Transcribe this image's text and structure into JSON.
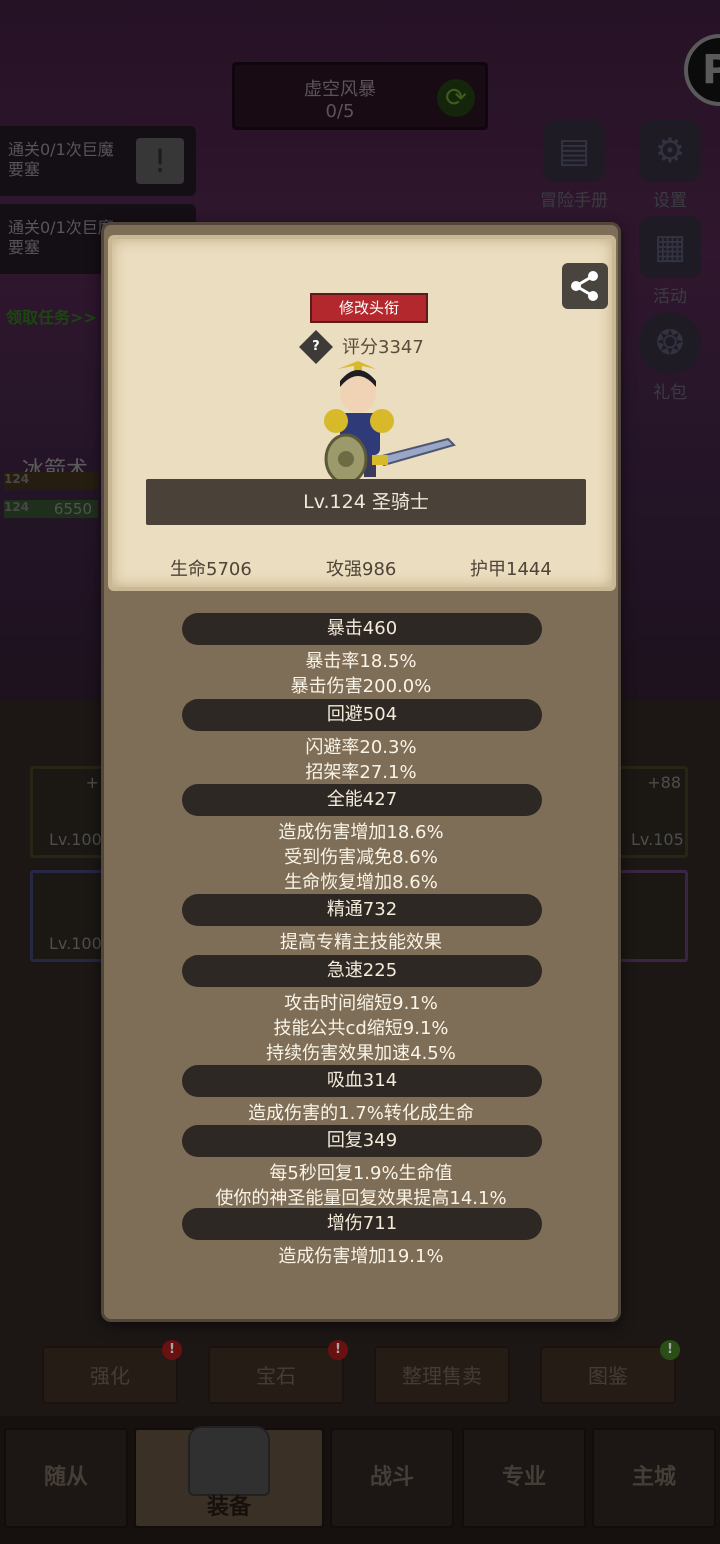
{
  "background": {
    "quest_title": "虚空风暴",
    "quest_progress": "0/5",
    "side_tasks": [
      "通关0/1次巨魔要塞",
      "通关0/1次巨魔要塞"
    ],
    "claim_task": "领取任务>>",
    "skill_name": "冰箭术",
    "level_tags": [
      "124",
      "124"
    ],
    "hp_values": [
      "6550"
    ],
    "right_buttons": [
      "冒险手册",
      "设置",
      "活动",
      "礼包"
    ],
    "equip_levels": [
      "Lv.100",
      "Lv.100",
      "Lv.105"
    ],
    "equip_plus": [
      "+",
      "+88"
    ],
    "action_buttons": [
      "强化",
      "宝石",
      "整理售卖",
      "图鉴"
    ],
    "nav_tabs": [
      "随从",
      "装备",
      "战斗",
      "专业",
      "主城"
    ]
  },
  "modal": {
    "title_button": "修改头衔",
    "help": "?",
    "score": "评分3347",
    "level_class": "Lv.124 圣骑士",
    "main_stats": [
      "生命5706",
      "攻强986",
      "护甲1444"
    ],
    "stats": [
      {
        "header": "暴击460",
        "lines": [
          "暴击率18.5%",
          "暴击伤害200.0%"
        ]
      },
      {
        "header": "回避504",
        "lines": [
          "闪避率20.3%",
          "招架率27.1%"
        ]
      },
      {
        "header": "全能427",
        "lines": [
          "造成伤害增加18.6%",
          "受到伤害减免8.6%",
          "生命恢复增加8.6%"
        ]
      },
      {
        "header": "精通732",
        "lines": [
          "提高专精主技能效果"
        ]
      },
      {
        "header": "急速225",
        "lines": [
          "攻击时间缩短9.1%",
          "技能公共cd缩短9.1%",
          "持续伤害效果加速4.5%"
        ]
      },
      {
        "header": "吸血314",
        "lines": [
          "造成伤害的1.7%转化成生命"
        ]
      },
      {
        "header": "回复349",
        "lines": [
          "每5秒回复1.9%生命值",
          "使你的神圣能量回复效果提高14.1%"
        ]
      },
      {
        "header": "增伤711",
        "lines": [
          "造成伤害增加19.1%"
        ]
      }
    ]
  }
}
